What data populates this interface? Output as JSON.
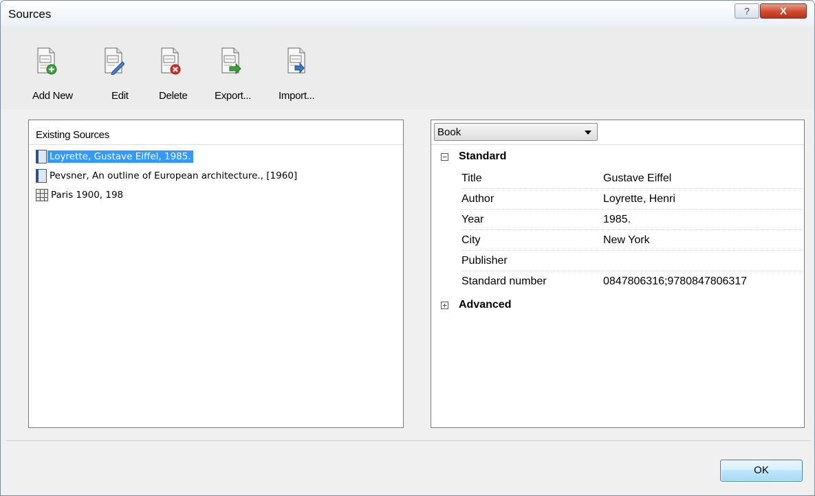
{
  "window": {
    "title": "Sources",
    "help_glyph": "?",
    "close_glyph": "X"
  },
  "toolbar": {
    "buttons": [
      {
        "label": "Add New",
        "icon": "add-document-icon"
      },
      {
        "label": "Edit",
        "icon": "edit-document-icon"
      },
      {
        "label": "Delete",
        "icon": "delete-document-icon"
      },
      {
        "label": "Export...",
        "icon": "export-document-icon"
      },
      {
        "label": "Import...",
        "icon": "import-document-icon"
      }
    ]
  },
  "existing_sources": {
    "header": "Existing Sources",
    "items": [
      {
        "label": "Loyrette, Gustave Eiffel, 1985.",
        "icon": "book-icon",
        "selected": true
      },
      {
        "label": "Pevsner, An outline of European architecture., [1960]",
        "icon": "book-icon",
        "selected": false
      },
      {
        "label": "Paris 1900, 198",
        "icon": "film-icon",
        "selected": false
      }
    ]
  },
  "details": {
    "source_type": "Book",
    "standard": {
      "label": "Standard",
      "expander": "−",
      "rows": [
        {
          "name": "Title",
          "value": "Gustave Eiffel"
        },
        {
          "name": "Author",
          "value": "Loyrette, Henri"
        },
        {
          "name": "Year",
          "value": "1985."
        },
        {
          "name": "City",
          "value": "New York"
        },
        {
          "name": "Publisher",
          "value": ""
        },
        {
          "name": "Standard number",
          "value": "0847806316;9780847806317"
        }
      ]
    },
    "advanced": {
      "label": "Advanced",
      "expander": "+"
    }
  },
  "footer": {
    "ok_label": "OK"
  }
}
